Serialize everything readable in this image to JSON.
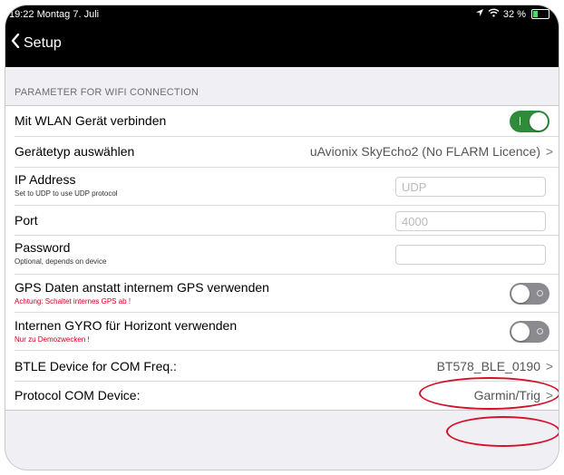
{
  "status_bar": {
    "time": "19:22",
    "date": "Montag 7. Juli",
    "battery": "32 %",
    "battery_level": 0.32,
    "icons": [
      "location-arrow-icon",
      "wifi-icon",
      "battery-charging-icon"
    ]
  },
  "nav": {
    "back_label": "Setup",
    "back_icon": "chevron-left-icon"
  },
  "section": {
    "header": "PARAMETER FOR WIFI CONNECTION"
  },
  "rows": {
    "wlan": {
      "title": "Mit WLAN Gerät verbinden",
      "toggle_on": true
    },
    "device_type": {
      "title": "Gerätetyp auswählen",
      "value": "uAvionix SkyEcho2 (No FLARM Licence)",
      "chevron": ">"
    },
    "ip": {
      "title": "IP Address",
      "subtitle": "Set to UDP to use UDP protocol",
      "placeholder": "UDP",
      "value": ""
    },
    "port": {
      "title": "Port",
      "placeholder": "4000",
      "value": ""
    },
    "password": {
      "title": "Password",
      "subtitle": "Optional, depends on device",
      "placeholder": "",
      "value": ""
    },
    "gps": {
      "title": "GPS Daten anstatt internem GPS verwenden",
      "subtitle": "Achtung: Schaltet internes GPS ab !",
      "toggle_on": false
    },
    "gyro": {
      "title": "Internen GYRO für Horizont verwenden",
      "subtitle": "Nur zu Demozwecken !",
      "toggle_on": false
    },
    "btle": {
      "title": "BTLE Device for COM Freq.:",
      "value": "BT578_BLE_0190",
      "chevron": ">"
    },
    "protocol": {
      "title": "Protocol COM Device:",
      "value": "Garmin/Trig",
      "chevron": ">"
    }
  },
  "colors": {
    "toggle_on": "#2e8b3a",
    "toggle_off": "#8a8a8f",
    "warning_text": "#d0021b",
    "annotation": "#d6112a",
    "bars": "#000000"
  }
}
